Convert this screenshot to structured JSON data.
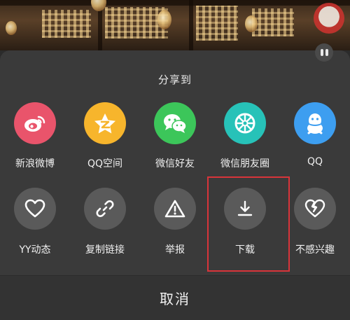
{
  "share_sheet": {
    "title": "分享到",
    "social_row": [
      {
        "label": "新浪微博",
        "icon": "weibo-icon",
        "color": "#e9546b"
      },
      {
        "label": "QQ空间",
        "icon": "qzone-icon",
        "color": "#f7b52c"
      },
      {
        "label": "微信好友",
        "icon": "wechat-icon",
        "color": "#3cc65a"
      },
      {
        "label": "微信朋友圈",
        "icon": "moments-icon",
        "color": "#27c2b8"
      },
      {
        "label": "QQ",
        "icon": "qq-icon",
        "color": "#3d9ef0"
      }
    ],
    "action_row": [
      {
        "label": "YY动态",
        "icon": "heart-outline-icon"
      },
      {
        "label": "复制链接",
        "icon": "link-icon"
      },
      {
        "label": "举报",
        "icon": "warning-icon"
      },
      {
        "label": "下载",
        "icon": "download-icon"
      },
      {
        "label": "不感兴趣",
        "icon": "broken-heart-icon"
      }
    ],
    "cancel_label": "取消",
    "highlight_color": "#d8343a"
  }
}
